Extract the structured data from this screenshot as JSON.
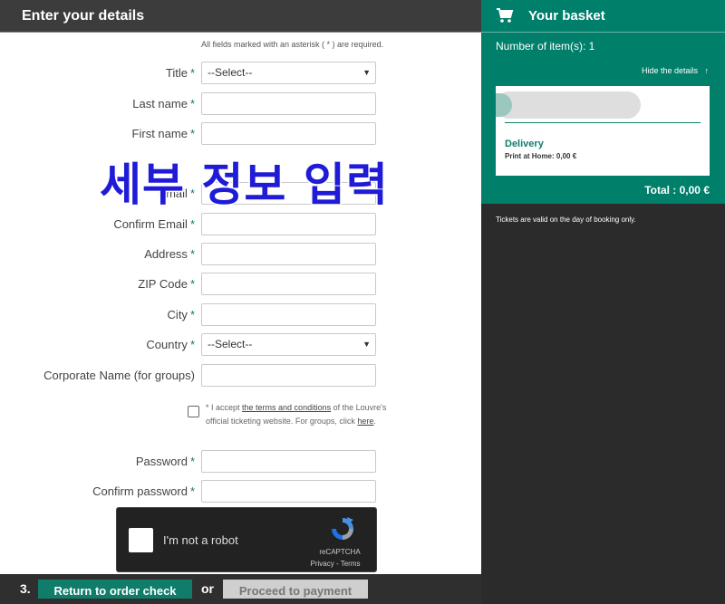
{
  "header": {
    "title": "Enter your details"
  },
  "required_note": "All fields marked with an asterisk ( * ) are required.",
  "form": {
    "title": {
      "label": "Title",
      "value": "--Select--"
    },
    "last_name": {
      "label": "Last name"
    },
    "first_name": {
      "label": "First name"
    },
    "email": {
      "label": "Email"
    },
    "confirm_email": {
      "label": "Confirm Email"
    },
    "address": {
      "label": "Address"
    },
    "zip": {
      "label": "ZIP Code"
    },
    "city": {
      "label": "City"
    },
    "country": {
      "label": "Country",
      "value": "--Select--"
    },
    "corporate": {
      "label": "Corporate Name (for groups)"
    },
    "password": {
      "label": "Password"
    },
    "confirm_password": {
      "label": "Confirm password"
    },
    "asterisk": "*"
  },
  "terms": {
    "prefix": "* I accept ",
    "link": "the terms and conditions",
    "middle": " of the Louvre's official ticketing website. For groups, click ",
    "here": "here",
    "suffix": "."
  },
  "captcha": {
    "label": "I'm not a robot",
    "brand": "reCAPTCHA",
    "links": "Privacy - Terms"
  },
  "footer": {
    "step": "3.",
    "return_label": "Return to order check",
    "or": "or",
    "pay_label": "Proceed to payment"
  },
  "overlay_text": "세부 정보 입력",
  "basket": {
    "title": "Your basket",
    "items": "Number of item(s): 1",
    "hide": "Hide the details",
    "hide_icon": "↑",
    "delivery": "Delivery",
    "print": "Print at Home: 0,00 €",
    "total": "Total : 0,00 €",
    "valid_note": "Tickets are valid on the day of booking only."
  },
  "colors": {
    "accent": "#007f6b",
    "header": "#3c3c3c",
    "overlay": "#1f1bd6"
  }
}
